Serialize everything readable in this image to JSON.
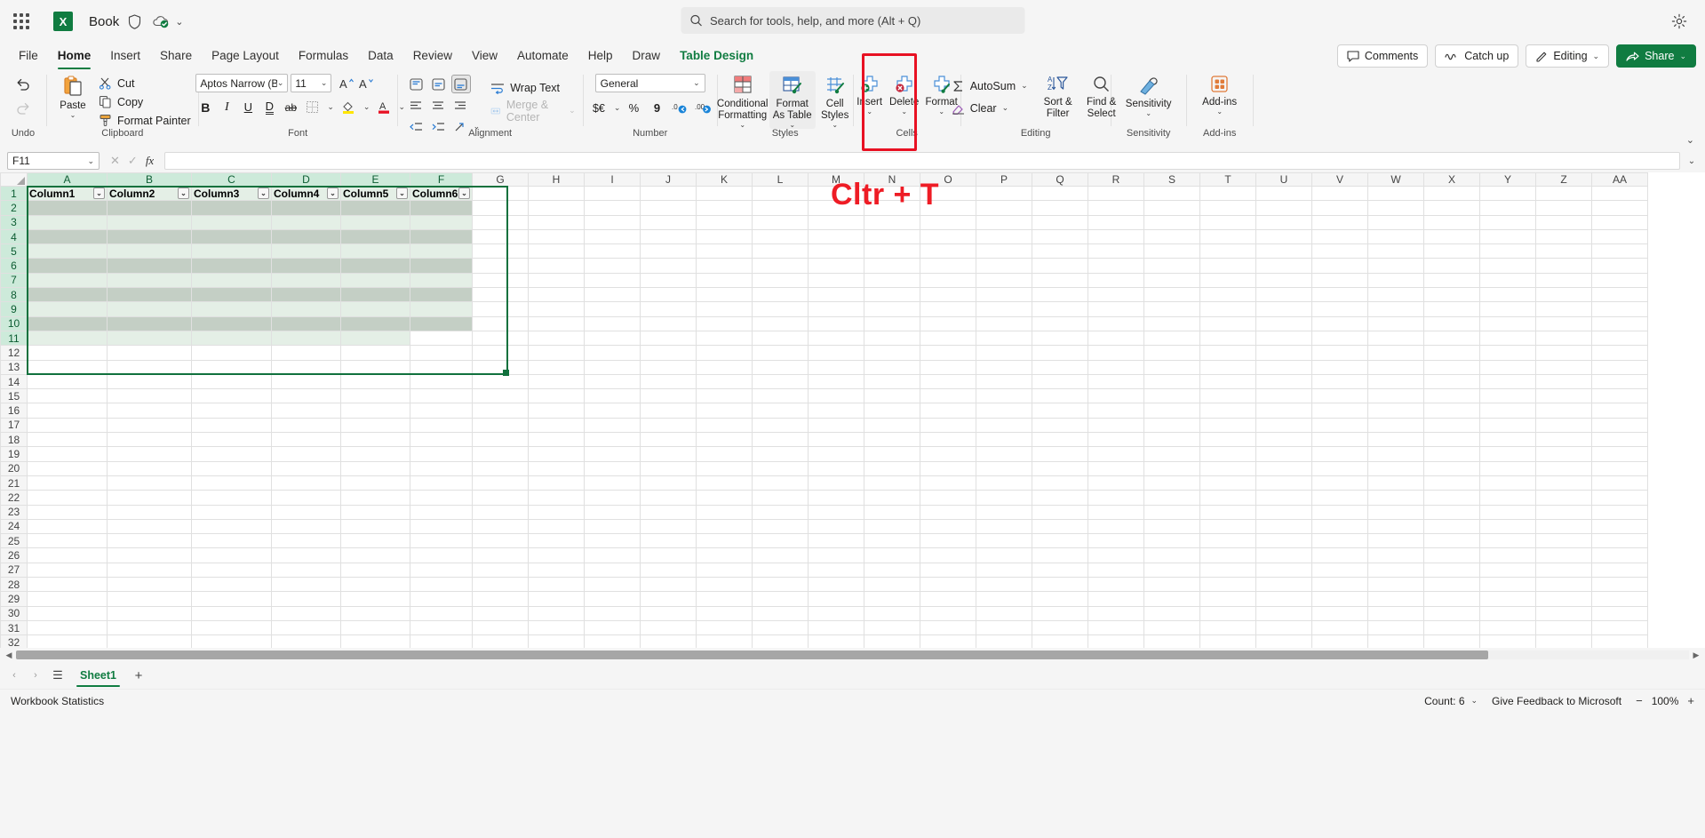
{
  "titlebar": {
    "app_launcher": "app-launcher",
    "logo_letter": "X",
    "book_name": "Book",
    "autosave_chevron": "⌄",
    "search_placeholder": "Search for tools, help, and more (Alt + Q)"
  },
  "tabs": [
    {
      "label": "File",
      "active": false,
      "contextual": false
    },
    {
      "label": "Home",
      "active": true,
      "contextual": false
    },
    {
      "label": "Insert",
      "active": false,
      "contextual": false
    },
    {
      "label": "Share",
      "active": false,
      "contextual": false
    },
    {
      "label": "Page Layout",
      "active": false,
      "contextual": false
    },
    {
      "label": "Formulas",
      "active": false,
      "contextual": false
    },
    {
      "label": "Data",
      "active": false,
      "contextual": false
    },
    {
      "label": "Review",
      "active": false,
      "contextual": false
    },
    {
      "label": "View",
      "active": false,
      "contextual": false
    },
    {
      "label": "Automate",
      "active": false,
      "contextual": false
    },
    {
      "label": "Help",
      "active": false,
      "contextual": false
    },
    {
      "label": "Draw",
      "active": false,
      "contextual": false
    },
    {
      "label": "Table Design",
      "active": false,
      "contextual": true
    }
  ],
  "tab_actions": {
    "comments": "Comments",
    "catch_up": "Catch up",
    "editing": "Editing",
    "share": "Share",
    "chevron": "⌄"
  },
  "ribbon": {
    "undo": {
      "group_label": "Undo",
      "undo": "Undo",
      "redo": "Redo"
    },
    "clipboard": {
      "group_label": "Clipboard",
      "paste": "Paste",
      "cut": "Cut",
      "copy": "Copy",
      "format_painter": "Format Painter"
    },
    "font": {
      "group_label": "Font",
      "font_name": "Aptos Narrow (Bo...",
      "font_size": "11",
      "bold": "B",
      "italic": "I",
      "underline": "U",
      "double_underline": "D",
      "strikethrough": "ab",
      "borders": "Borders",
      "grow_font": "A",
      "shrink_font": "A",
      "fill_color": "Fill Color",
      "font_color": "Font Color",
      "chevron": "⌄"
    },
    "alignment": {
      "group_label": "Alignment",
      "wrap_text": "Wrap Text",
      "merge_center": "Merge & Center",
      "chevron": "⌄"
    },
    "number": {
      "group_label": "Number",
      "format": "General",
      "accounting": "$€",
      "percent": "%",
      "comma": "9",
      "decrease_decimal": ".0",
      "increase_decimal": ".00",
      "chevron": "⌄"
    },
    "styles": {
      "group_label": "Styles",
      "conditional_formatting": "Conditional Formatting",
      "format_as_table": "Format As Table",
      "cell_styles": "Cell Styles",
      "chevron": "⌄",
      "highlight_color": "#e81123"
    },
    "cells": {
      "group_label": "Cells",
      "insert": "Insert",
      "delete": "Delete",
      "format": "Format",
      "chevron": "⌄"
    },
    "editing": {
      "group_label": "Editing",
      "autosum": "AutoSum",
      "clear": "Clear",
      "sort_filter": "Sort & Filter",
      "find_select": "Find & Select",
      "chevron": "⌄"
    },
    "sensitivity": {
      "group_label": "Sensitivity",
      "label": "Sensitivity",
      "chevron": "⌄"
    },
    "addins": {
      "group_label": "Add-ins",
      "label": "Add-ins",
      "chevron": "⌄"
    },
    "collapse": "⌄"
  },
  "formula_bar": {
    "name_box": "F11",
    "cancel": "✕",
    "enter": "✓",
    "insert_function": "fx",
    "formula_value": "",
    "expand": "⌄"
  },
  "grid": {
    "columns": [
      "A",
      "B",
      "C",
      "D",
      "E",
      "F",
      "G",
      "H",
      "I",
      "J",
      "K",
      "L",
      "M",
      "N",
      "O",
      "P",
      "Q",
      "R",
      "S",
      "T",
      "U",
      "V",
      "W",
      "X",
      "Y",
      "Z",
      "AA"
    ],
    "selected_columns": [
      "A",
      "B",
      "C",
      "D",
      "E",
      "F"
    ],
    "rows": [
      1,
      2,
      3,
      4,
      5,
      6,
      7,
      8,
      9,
      10,
      11,
      12,
      13,
      14,
      15,
      16,
      17,
      18,
      19,
      20,
      21,
      22,
      23,
      24,
      25,
      26,
      27,
      28,
      29,
      30,
      31,
      32
    ],
    "selected_rows": [
      1,
      2,
      3,
      4,
      5,
      6,
      7,
      8,
      9,
      10,
      11
    ],
    "table": {
      "headers": [
        "Column1",
        "Column2",
        "Column3",
        "Column4",
        "Column5",
        "Column6"
      ],
      "filter_glyph": "⌄",
      "first_row": 1,
      "last_row": 11,
      "active_cell": "F11",
      "border_color": "#11713d",
      "header_bg": "#e4efe6",
      "band_bg": "#c4cfc5",
      "plain_bg": "#e4efe6"
    },
    "annotation": {
      "text": "Cltr + T",
      "color": "#ee1c25"
    }
  },
  "sheetbar": {
    "prev": "‹",
    "next": "›",
    "all_sheets": "☰",
    "sheets": [
      "Sheet1"
    ],
    "add_sheet": "+"
  },
  "statusbar": {
    "workbook_statistics": "Workbook Statistics",
    "count": "Count: 6",
    "count_chevron": "⌄",
    "feedback": "Give Feedback to Microsoft",
    "zoom_out": "−",
    "zoom_level": "100%",
    "zoom_in": "+"
  }
}
